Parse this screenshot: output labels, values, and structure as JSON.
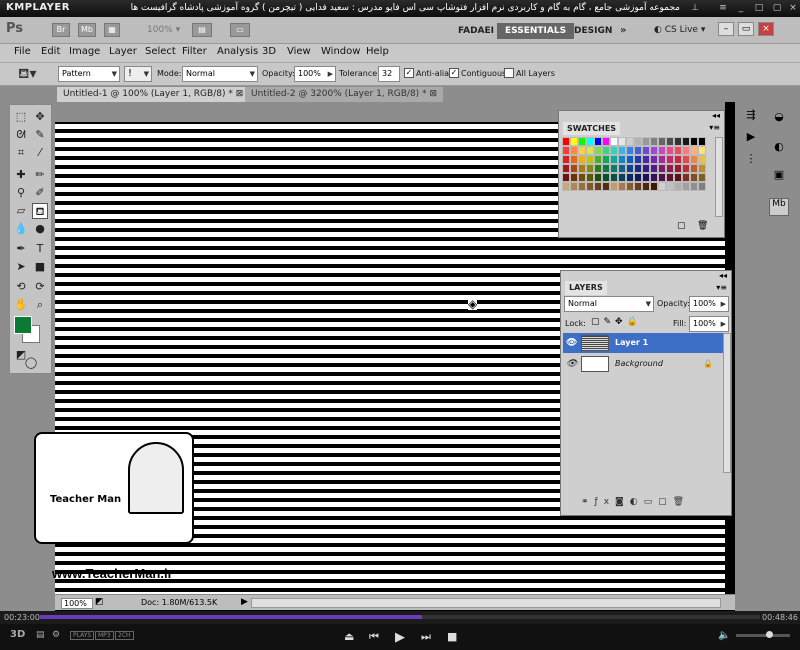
{
  "km": {
    "logo": "KMPLAYER",
    "title": "مجموعه آموزشی جامع ، گام به گام و کاربردی نرم افزار فتوشاپ سی اس فایو  مدرس : سعید فدایی ( تیچرمن ) گروه آموزشی پادشاه گرافیست ها",
    "time_current": "00:23:00",
    "time_total": "00:48:46",
    "progress_fraction": 0.53,
    "badges": [
      "3D",
      "PLAYS",
      "MP3",
      "2CH"
    ]
  },
  "app": {
    "logo": "Ps",
    "bridge": "Br",
    "mini": "Mb",
    "zoom": "100%",
    "workspaces": [
      "FADAEI",
      "ESSENTIALS",
      "DESIGN"
    ],
    "cslive": "CS Live"
  },
  "menu": [
    "File",
    "Edit",
    "Image",
    "Layer",
    "Select",
    "Filter",
    "Analysis",
    "3D",
    "View",
    "Window",
    "Help"
  ],
  "options": {
    "fill_source": "Pattern",
    "mode_label": "Mode:",
    "mode": "Normal",
    "opacity_label": "Opacity:",
    "opacity": "100%",
    "tolerance_label": "Tolerance:",
    "tolerance": "32",
    "antialias": "Anti-alias",
    "contiguous": "Contiguous",
    "all_layers": "All Layers"
  },
  "tabs": [
    "Untitled-1 @ 100% (Layer 1, RGB/8) *",
    "Untitled-2 @ 3200% (Layer 1, RGB/8) *"
  ],
  "swatches": {
    "title": "SWATCHES",
    "colors": [
      "#ff0000",
      "#ffff00",
      "#00ff00",
      "#00ffff",
      "#0000ff",
      "#ff00ff",
      "#ffffff",
      "#e6e6e6",
      "#cccccc",
      "#b3b3b3",
      "#999999",
      "#808080",
      "#666666",
      "#4d4d4d",
      "#333333",
      "#1a1a1a",
      "#000000",
      "#000000",
      "#ff3b3b",
      "#ff8a3d",
      "#ffd23d",
      "#d6e84a",
      "#7fdc4f",
      "#3bd57a",
      "#3bd0c4",
      "#3bb3e8",
      "#3b7ee8",
      "#4a5fd0",
      "#6b4ad0",
      "#9c4ad0",
      "#c94ab8",
      "#e84a8e",
      "#e84a5f",
      "#ff7a7a",
      "#ffb07a",
      "#ffe07a",
      "#e02020",
      "#e86a10",
      "#e8b410",
      "#b8c810",
      "#4cb02a",
      "#10a85a",
      "#10a898",
      "#1088c8",
      "#105cc8",
      "#2838b0",
      "#4828b0",
      "#7828b0",
      "#a82898",
      "#c82868",
      "#c82840",
      "#e84848",
      "#e88848",
      "#e8c048",
      "#a01818",
      "#a84810",
      "#a87c10",
      "#808c10",
      "#2c7c1c",
      "#107840",
      "#10786c",
      "#106090",
      "#104090",
      "#1c2880",
      "#341c80",
      "#541c80",
      "#781c6c",
      "#901c48",
      "#901c2c",
      "#b83030",
      "#b86030",
      "#b89030",
      "#701010",
      "#703008",
      "#705008",
      "#545c08",
      "#1c5010",
      "#08502c",
      "#085048",
      "#084060",
      "#082c60",
      "#101c58",
      "#201058",
      "#381058",
      "#501048",
      "#601030",
      "#60101c",
      "#803020",
      "#805020",
      "#806020",
      "#c8a878",
      "#b08858",
      "#987040",
      "#805830",
      "#684020",
      "#503010",
      "#c89a6a",
      "#a87a4a",
      "#8a5a2a",
      "#6a3a1a",
      "#4a2a0a",
      "#3a1a00",
      "#d0d0d0",
      "#c0c0c0",
      "#b0b0b0",
      "#a0a0a0",
      "#909090",
      "#808080"
    ]
  },
  "layers": {
    "title": "LAYERS",
    "blend": "Normal",
    "opacity_label": "Opacity:",
    "opacity": "100%",
    "lock_label": "Lock:",
    "fill_label": "Fill:",
    "fill": "100%",
    "items": [
      {
        "name": "Layer 1"
      },
      {
        "name": "Background"
      }
    ]
  },
  "status": {
    "zoom": "100%",
    "doc": "Doc: 1.80M/613.5K"
  },
  "watermark": {
    "brand_en": "Teacher Man",
    "url": "www.TeacherMan.ir"
  }
}
